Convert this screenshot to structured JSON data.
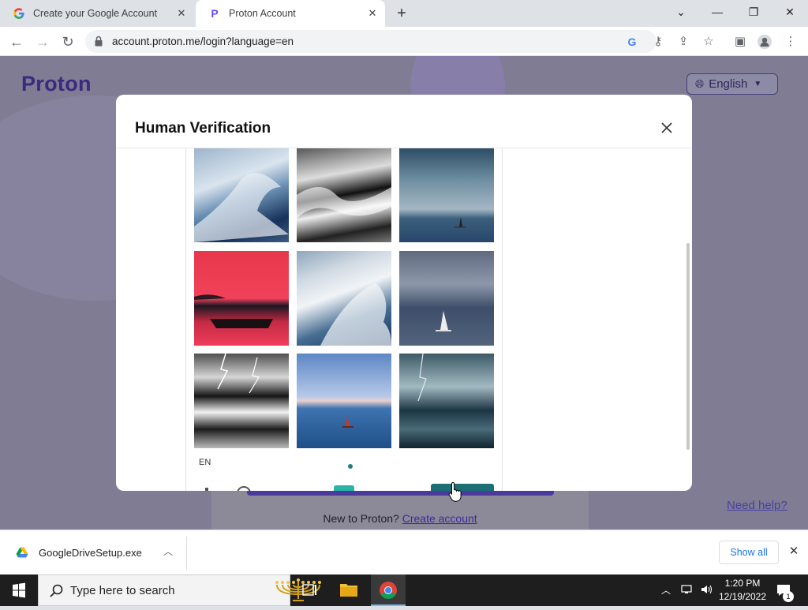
{
  "browser": {
    "tabs": [
      {
        "title": "Create your Google Account",
        "favicon": "google-g-icon",
        "active": false
      },
      {
        "title": "Proton Account",
        "favicon": "proton-p-icon",
        "active": true
      }
    ],
    "url": "account.proton.me/login?language=en"
  },
  "page": {
    "brand": "Proton",
    "language_button": "English",
    "new_to_text": "New to Proton?",
    "create_account_link": "Create account",
    "need_help_link": "Need help?"
  },
  "modal": {
    "title": "Human Verification",
    "captcha": {
      "language": "EN",
      "images": [
        {
          "subject": "breaking-wave-blue"
        },
        {
          "subject": "breaking-wave-monochrome"
        },
        {
          "subject": "cloudy-sea-sailboat"
        },
        {
          "subject": "red-sunset-rowboat"
        },
        {
          "subject": "big-wave-blue"
        },
        {
          "subject": "sailboat-stormy-sky"
        },
        {
          "subject": "lightning-waves-monochrome"
        },
        {
          "subject": "blue-sea-small-boat"
        },
        {
          "subject": "storm-lightning-sea"
        }
      ]
    }
  },
  "downloads": {
    "file_name": "GoogleDriveSetup.exe",
    "show_all_label": "Show all"
  },
  "taskbar": {
    "search_placeholder": "Type here to search",
    "time": "1:20 PM",
    "date": "12/19/2022",
    "notification_count": "1"
  }
}
